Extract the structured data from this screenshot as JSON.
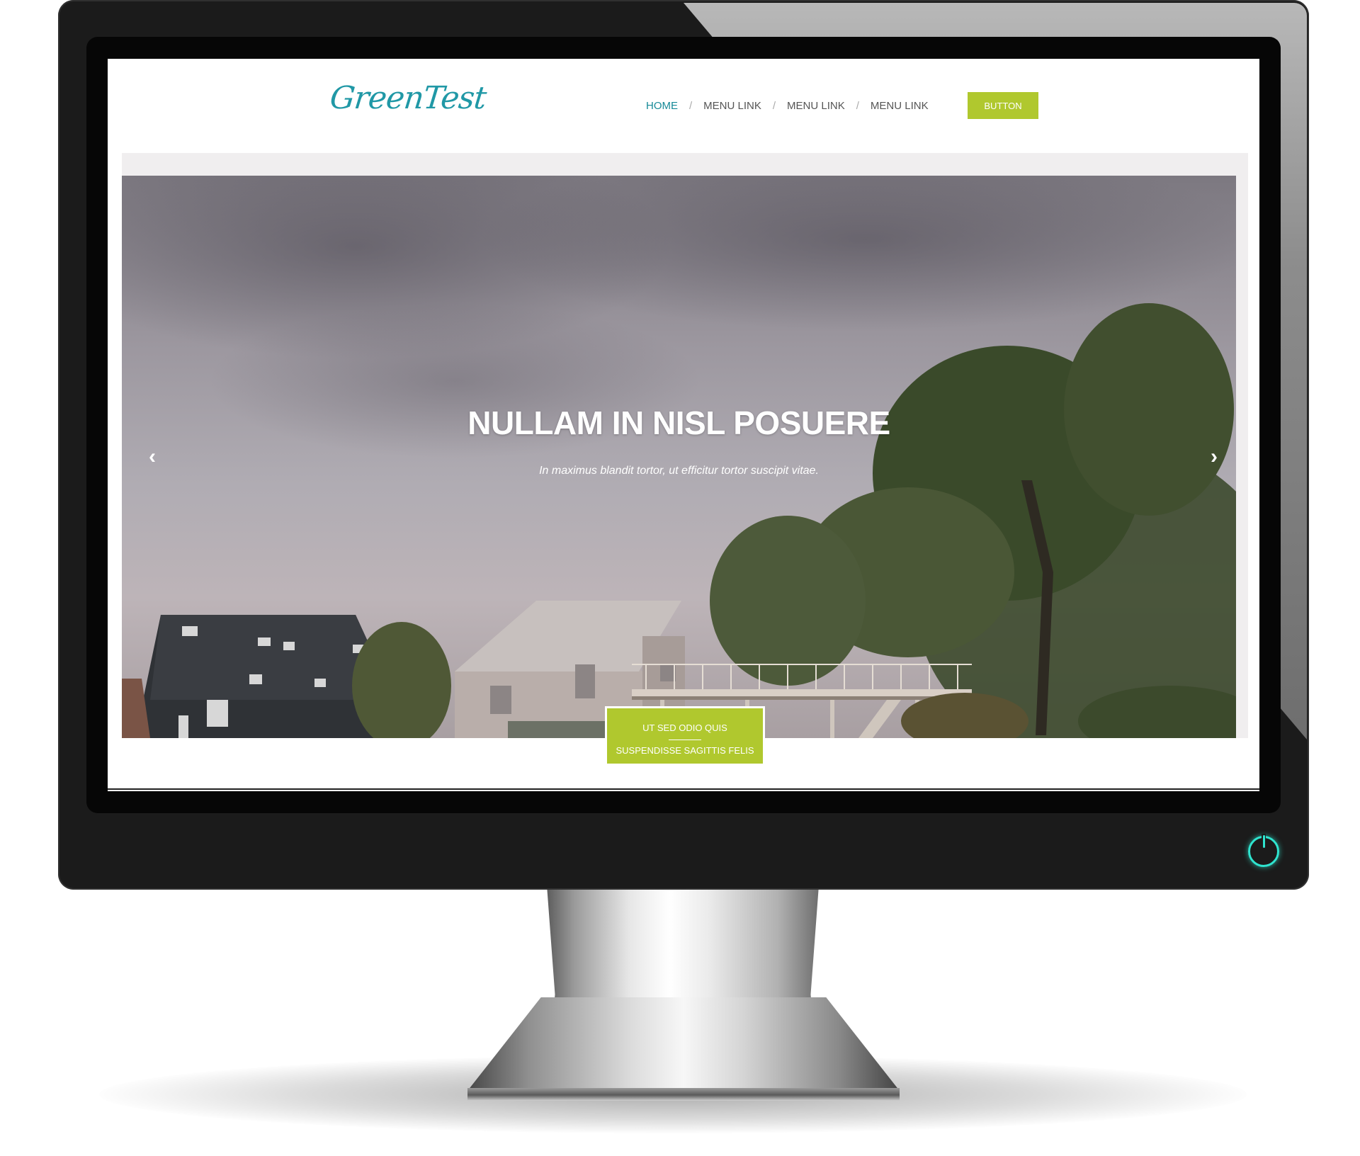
{
  "site": {
    "logo_text": "GreenTest",
    "nav": {
      "items": [
        {
          "label": "HOME",
          "active": true
        },
        {
          "label": "MENU LINK",
          "active": false
        },
        {
          "label": "MENU LINK",
          "active": false
        },
        {
          "label": "MENU LINK",
          "active": false
        }
      ],
      "separator": "/"
    },
    "header_button_label": "BUTTON"
  },
  "hero": {
    "title": "NULLAM IN NISL POSUERE",
    "subtitle": "In maximus blandit tortor, ut efficitur tortor suscipit vitae.",
    "prev_arrow": "‹",
    "next_arrow": "›"
  },
  "cta": {
    "line1": "UT SED ODIO QUIS",
    "line2": "SUSPENDISSE SAGITTIS FELIS"
  },
  "icons": {
    "power": "power-icon",
    "prev": "chevron-left-icon",
    "next": "chevron-right-icon"
  },
  "colors": {
    "accent_green": "#b0c82e",
    "logo_teal": "#2098a6",
    "nav_active": "#178a98",
    "power_glow": "#2fe4cf",
    "bezel": "#1b1b1b"
  }
}
